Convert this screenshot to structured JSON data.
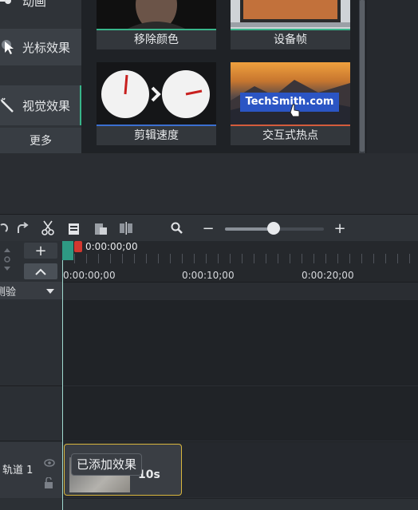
{
  "sidebar": {
    "items": [
      {
        "label": "动画",
        "icon": "animation-icon"
      },
      {
        "label": "光标效果",
        "icon": "cursor-effects-icon"
      },
      {
        "label": "视觉效果",
        "icon": "magic-wand-icon"
      }
    ],
    "more_label": "更多"
  },
  "library": {
    "tiles": [
      {
        "label": "移除颜色"
      },
      {
        "label": "设备帧"
      },
      {
        "label": "剪辑速度"
      },
      {
        "label": "交互式热点",
        "thumb_text": "TechSmith.com"
      }
    ]
  },
  "toolbar": {
    "icons": [
      "redo-icon",
      "cut-icon",
      "copy-icon",
      "paste-icon",
      "split-icon",
      "zoom-icon"
    ],
    "zoom_minus": "−",
    "zoom_plus": "+",
    "zoom_level": 0.5
  },
  "timeline": {
    "playhead_time": "0:00:00;00",
    "ruler_marks": [
      "0:00:00;00",
      "0:00:10;00",
      "0:00:20;00"
    ],
    "add_track": "+",
    "track_selector": "测验",
    "track_name": "轨道 1",
    "clip_label": "10s",
    "tooltip": "已添加效果"
  },
  "colors": {
    "accent_green": "#38b58a",
    "clip_border": "#d9b63d",
    "playhead_red": "#d4382f"
  }
}
